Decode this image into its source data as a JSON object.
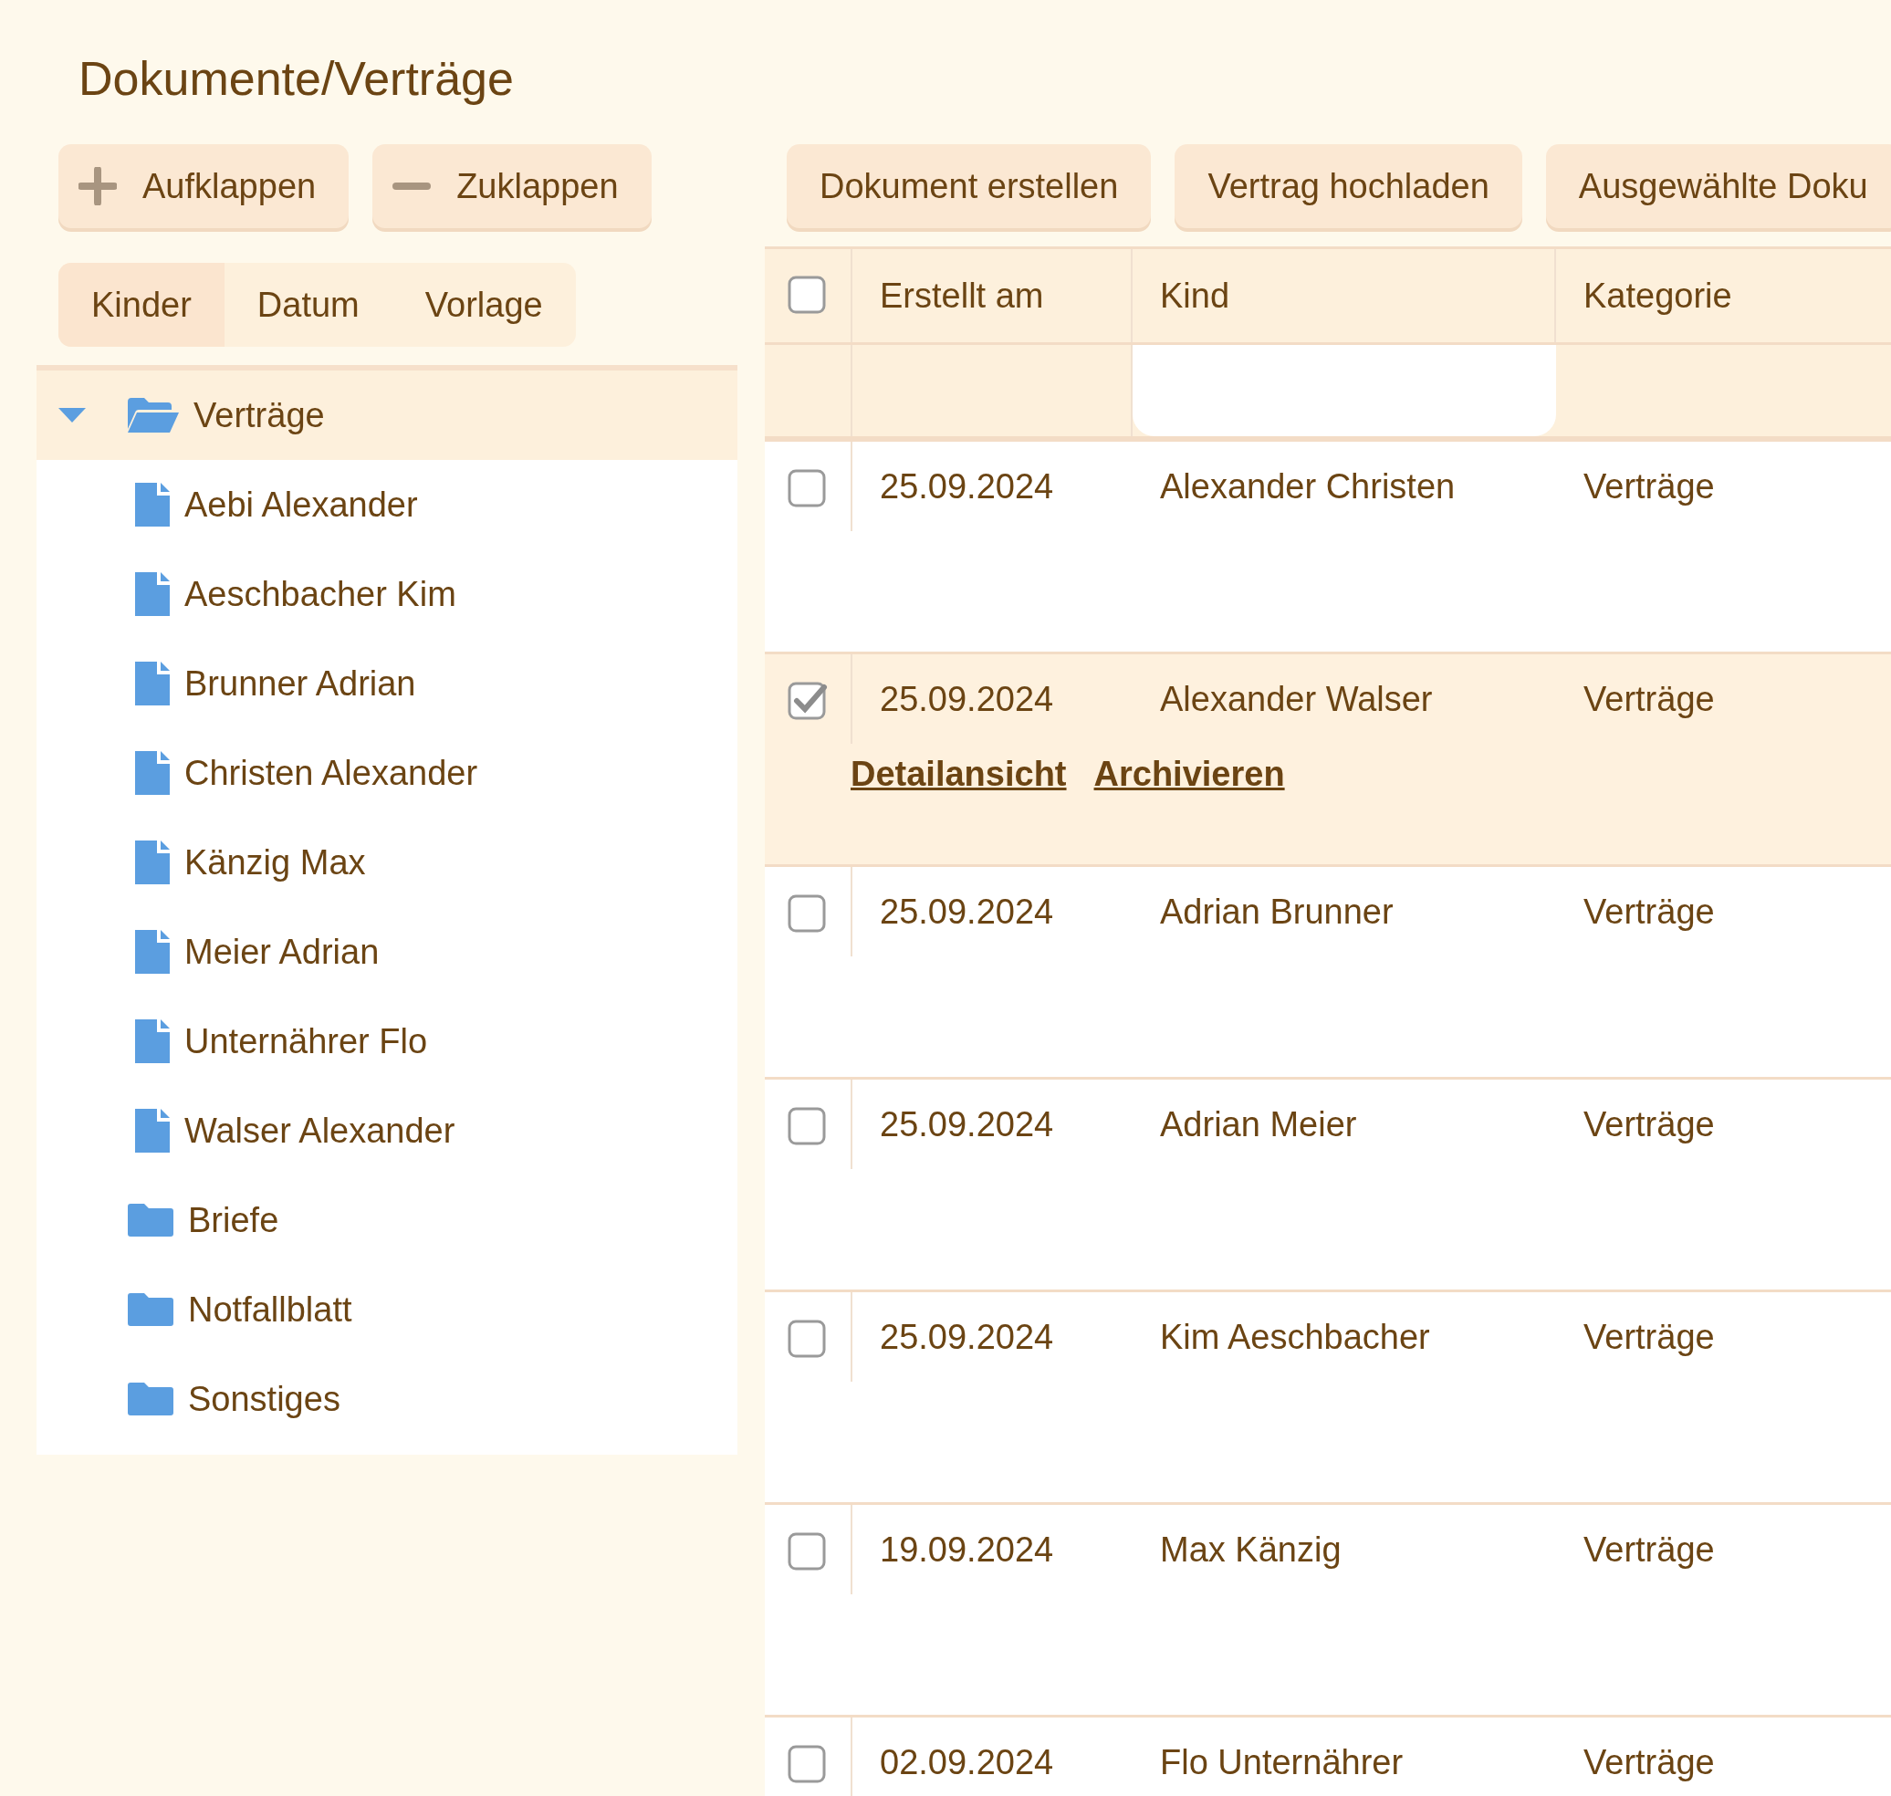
{
  "title": "Dokumente/Verträge",
  "tree_buttons": [
    {
      "kind": "expand",
      "label": "Aufklappen"
    },
    {
      "kind": "collapse",
      "label": "Zuklappen"
    }
  ],
  "tabs": [
    {
      "label": "Kinder",
      "selected": true
    },
    {
      "label": "Datum",
      "selected": false
    },
    {
      "label": "Vorlage",
      "selected": false
    }
  ],
  "tree": [
    {
      "label": "Verträge",
      "kind": "folder",
      "expanded": true,
      "selected": true,
      "children": [
        {
          "label": "Aebi Alexander",
          "kind": "file",
          "selected": false
        },
        {
          "label": "Aeschbacher Kim",
          "kind": "file",
          "selected": false
        },
        {
          "label": "Brunner Adrian",
          "kind": "file",
          "selected": false
        },
        {
          "label": "Christen Alexander",
          "kind": "file",
          "selected": false
        },
        {
          "label": "Känzig Max",
          "kind": "file",
          "selected": false
        },
        {
          "label": "Meier Adrian",
          "kind": "file",
          "selected": false
        },
        {
          "label": "Unternährer Flo",
          "kind": "file",
          "selected": false
        },
        {
          "label": "Walser Alexander",
          "kind": "file",
          "selected": false
        }
      ]
    },
    {
      "label": "Briefe",
      "kind": "folder",
      "expanded": false,
      "selected": false
    },
    {
      "label": "Notfallblatt",
      "kind": "folder",
      "expanded": false,
      "selected": false
    },
    {
      "label": "Sonstiges",
      "kind": "folder",
      "expanded": false,
      "selected": false
    }
  ],
  "actions": [
    "Dokument erstellen",
    "Vertrag hochladen",
    "Ausgewählte Doku"
  ],
  "table": {
    "select_all": {
      "checked": false
    },
    "columns": [
      "Erstellt am",
      "Kind",
      "Kategorie"
    ],
    "rows": [
      {
        "checked": false,
        "date": "25.09.2024",
        "kind": "Alexander Christen",
        "category": "Verträge"
      },
      {
        "checked": true,
        "date": "25.09.2024",
        "kind": "Alexander Walser",
        "category": "Verträge",
        "links": [
          "Detailansicht",
          "Archivieren"
        ]
      },
      {
        "checked": false,
        "date": "25.09.2024",
        "kind": "Adrian Brunner",
        "category": "Verträge"
      },
      {
        "checked": false,
        "date": "25.09.2024",
        "kind": "Adrian Meier",
        "category": "Verträge"
      },
      {
        "checked": false,
        "date": "25.09.2024",
        "kind": "Kim Aeschbacher",
        "category": "Verträge"
      },
      {
        "checked": false,
        "date": "19.09.2024",
        "kind": "Max Känzig",
        "category": "Verträge"
      },
      {
        "checked": false,
        "date": "02.09.2024",
        "kind": "Flo Unternährer",
        "category": "Verträge"
      }
    ]
  }
}
